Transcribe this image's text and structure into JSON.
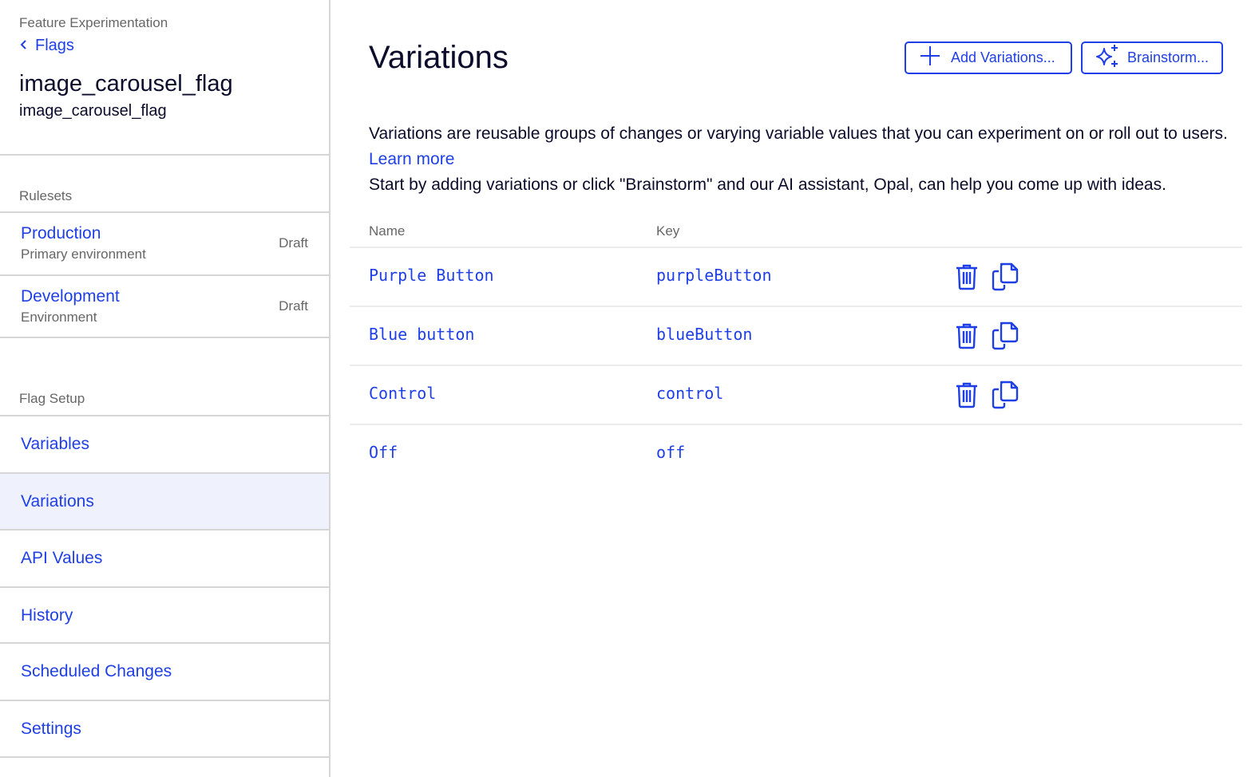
{
  "sidebar": {
    "breadcrumb": "Feature Experimentation",
    "back_label": "Flags",
    "flag_name": "image_carousel_flag",
    "flag_key": "image_carousel_flag",
    "rulesets_label": "Rulesets",
    "rulesets": [
      {
        "name": "Production",
        "description": "Primary environment",
        "status": "Draft"
      },
      {
        "name": "Development",
        "description": "Environment",
        "status": "Draft"
      }
    ],
    "setup_label": "Flag Setup",
    "nav_items": [
      {
        "label": "Variables"
      },
      {
        "label": "Variations",
        "active": true
      },
      {
        "label": "API Values"
      },
      {
        "label": "History"
      },
      {
        "label": "Scheduled Changes"
      },
      {
        "label": "Settings"
      }
    ]
  },
  "main": {
    "title": "Variations",
    "add_button": "Add Variations...",
    "brainstorm_button": "Brainstorm...",
    "description_1": "Variations are reusable groups of changes or varying variable values that you can experiment on or roll out to users.",
    "learn_more": "Learn more",
    "description_2": "Start by adding variations or click \"Brainstorm\" and our AI assistant, Opal, can help you come up with ideas.",
    "table": {
      "columns": [
        "Name",
        "Key"
      ],
      "rows": [
        {
          "name": "Purple Button",
          "key": "purpleButton",
          "actions": [
            "delete-icon",
            "copy-icon"
          ]
        },
        {
          "name": "Blue button",
          "key": "blueButton",
          "actions": [
            "delete-icon",
            "copy-icon"
          ]
        },
        {
          "name": "Control",
          "key": "control",
          "actions": [
            "delete-icon",
            "copy-icon"
          ]
        },
        {
          "name": "Off",
          "key": "off",
          "actions": []
        }
      ]
    }
  },
  "colors": {
    "accent": "#1f3fe6",
    "active_bg": "#eff1fc",
    "muted_text": "#666666",
    "divider": "#d6d6d6"
  }
}
